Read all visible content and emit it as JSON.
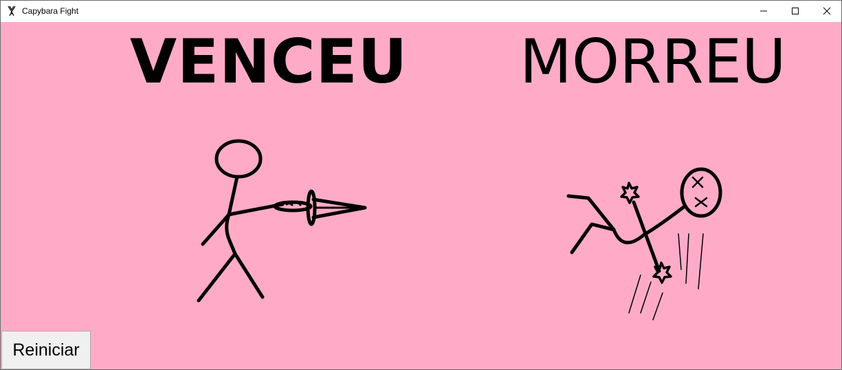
{
  "window": {
    "title": "Capybara Fight",
    "icon": "fencer-icon"
  },
  "controls": {
    "minimize_icon": "minimize-icon",
    "maximize_icon": "maximize-icon",
    "close_icon": "close-icon"
  },
  "game": {
    "background_color": "#ffabc8",
    "winner_text": "VENCEU",
    "loser_text": "MORREU",
    "winner_figure": "stick-figure-with-sword-icon",
    "loser_figure": "dead-stick-figure-icon",
    "restart_label": "Reiniciar"
  }
}
